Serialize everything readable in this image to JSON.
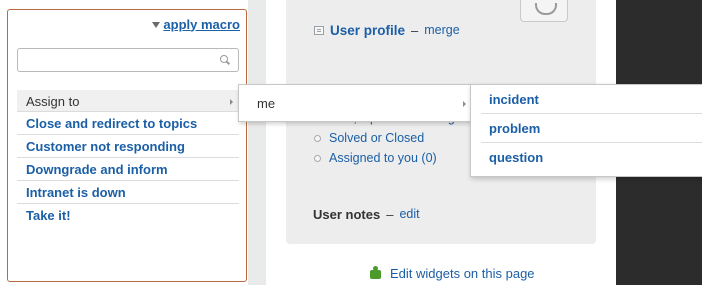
{
  "macro": {
    "header_label": "apply macro",
    "search": {
      "value": "",
      "placeholder": ""
    },
    "items": [
      {
        "label": "Assign to",
        "has_submenu": true
      },
      {
        "label": "Close and redirect to topics",
        "has_submenu": false
      },
      {
        "label": "Customer not responding",
        "has_submenu": false
      },
      {
        "label": "Downgrade and inform",
        "has_submenu": false
      },
      {
        "label": "Intranet is down",
        "has_submenu": false
      },
      {
        "label": "Take it!",
        "has_submenu": false
      }
    ]
  },
  "submenu_me": {
    "label": "me"
  },
  "submenu_types": {
    "items": [
      {
        "label": "incident"
      },
      {
        "label": "problem"
      },
      {
        "label": "question"
      }
    ]
  },
  "user_widget": {
    "profile_link": "User profile",
    "separator": "–",
    "merge_link": "merge",
    "ticket_links": [
      {
        "label": "New, Open or Pending"
      },
      {
        "label": "Solved or Closed"
      },
      {
        "label": "Assigned to you (0)"
      }
    ],
    "notes_label": "User notes",
    "notes_edit": "edit"
  },
  "footer": {
    "edit_widgets": "Edit widgets on this page"
  },
  "colors": {
    "link_blue": "#1b5fa6",
    "panel_border": "#b86a3e",
    "widget_bg": "#ededed",
    "dark_panel": "#2c2c2c"
  },
  "icons": [
    "triangle-down-icon",
    "search-icon",
    "chevron-right-icon",
    "user-card-icon",
    "radio-bullet-icon",
    "puzzle-piece-icon"
  ]
}
